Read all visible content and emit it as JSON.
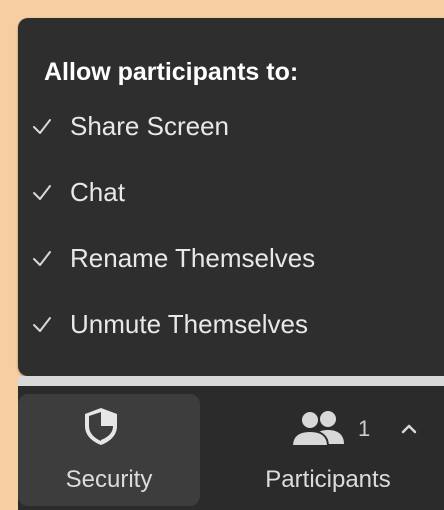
{
  "menu": {
    "title": "Allow participants to:",
    "items": [
      {
        "label": "Share Screen",
        "checked": true
      },
      {
        "label": "Chat",
        "checked": true
      },
      {
        "label": "Rename Themselves",
        "checked": true
      },
      {
        "label": "Unmute Themselves",
        "checked": true
      }
    ]
  },
  "toolbar": {
    "security": {
      "label": "Security",
      "icon": "shield-icon"
    },
    "participants": {
      "label": "Participants",
      "count": "1",
      "icon": "participants-icon",
      "menu_icon": "chevron-up-icon"
    }
  },
  "colors": {
    "background": "#f7cda2",
    "menu": "#2e2e2e",
    "toolbar": "#2b2b2b",
    "active_button": "#3d3d3d",
    "text": "#e8e8e8"
  }
}
